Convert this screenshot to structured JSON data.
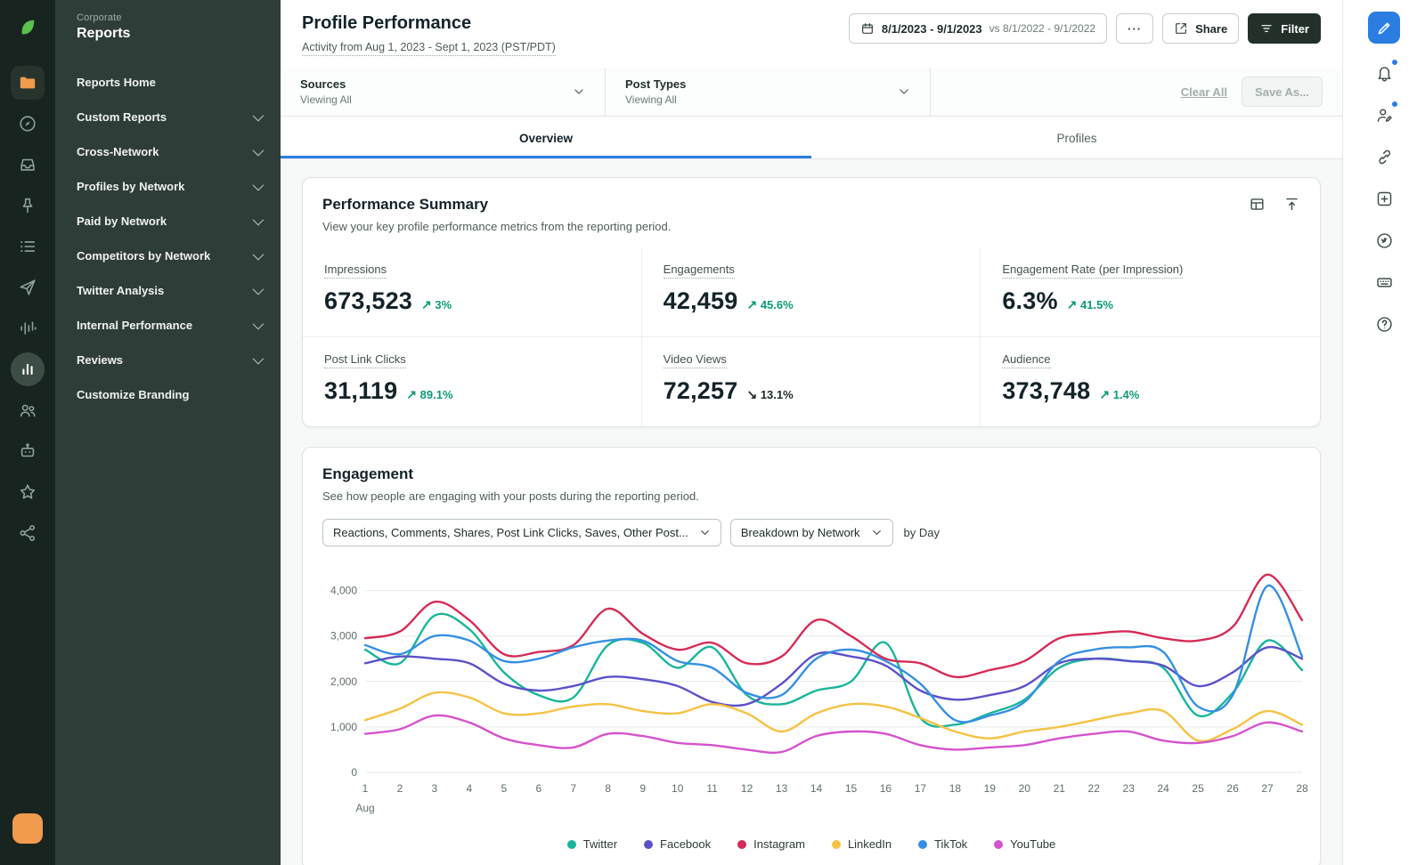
{
  "colors": {
    "accent_blue": "#2b7de1",
    "sprout_green": "#5bc14d",
    "rail_orange": "#f09b4e",
    "positive_trend": "#0c9a77",
    "filter_button_bg": "#233029"
  },
  "left_rail": {
    "icons": [
      "sprout-logo",
      "folder-icon",
      "compass-icon",
      "inbox-icon",
      "pin-icon",
      "list-icon",
      "send-icon",
      "listening-icon",
      "bar-chart-icon",
      "people-icon",
      "bot-icon",
      "star-icon",
      "network-icon",
      "avatar"
    ]
  },
  "right_rail": {
    "icons": [
      "compose-icon",
      "bell-icon",
      "user-edit-icon",
      "link-icon",
      "add-square-icon",
      "bird-icon",
      "keyboard-icon",
      "help-icon"
    ]
  },
  "sidebar": {
    "eyebrow": "Corporate",
    "title": "Reports",
    "items": [
      {
        "label": "Reports Home",
        "chevron": false
      },
      {
        "label": "Custom Reports",
        "chevron": true
      },
      {
        "label": "Cross-Network",
        "chevron": true
      },
      {
        "label": "Profiles by Network",
        "chevron": true
      },
      {
        "label": "Paid by Network",
        "chevron": true
      },
      {
        "label": "Competitors by Network",
        "chevron": true
      },
      {
        "label": "Twitter Analysis",
        "chevron": true
      },
      {
        "label": "Internal Performance",
        "chevron": true
      },
      {
        "label": "Reviews",
        "chevron": true
      },
      {
        "label": "Customize Branding",
        "chevron": false
      }
    ]
  },
  "header": {
    "title": "Profile Performance",
    "subtitle": "Activity from Aug 1, 2023 - Sept 1, 2023 (PST/PDT)",
    "date_range": "8/1/2023 - 9/1/2023",
    "date_compare": "vs 8/1/2022 - 9/1/2022",
    "more_label": "···",
    "share_label": "Share",
    "filter_label": "Filter"
  },
  "filters": {
    "sources_label": "Sources",
    "sources_value": "Viewing All",
    "post_types_label": "Post Types",
    "post_types_value": "Viewing All",
    "clear_all_label": "Clear All",
    "save_as_label": "Save As..."
  },
  "tabs": [
    {
      "label": "Overview",
      "active": true
    },
    {
      "label": "Profiles",
      "active": false
    }
  ],
  "performance_summary": {
    "title": "Performance Summary",
    "description": "View your key profile performance metrics from the reporting period.",
    "metrics": [
      {
        "label": "Impressions",
        "value": "673,523",
        "arrow": "↗",
        "trend": "3%",
        "direction": "up"
      },
      {
        "label": "Engagements",
        "value": "42,459",
        "arrow": "↗",
        "trend": "45.6%",
        "direction": "up"
      },
      {
        "label": "Engagement Rate (per Impression)",
        "value": "6.3%",
        "arrow": "↗",
        "trend": "41.5%",
        "direction": "up"
      },
      {
        "label": "Post Link Clicks",
        "value": "31,119",
        "arrow": "↗",
        "trend": "89.1%",
        "direction": "up"
      },
      {
        "label": "Video Views",
        "value": "72,257",
        "arrow": "↘",
        "trend": "13.1%",
        "direction": "down"
      },
      {
        "label": "Audience",
        "value": "373,748",
        "arrow": "↗",
        "trend": "1.4%",
        "direction": "up"
      }
    ]
  },
  "engagement": {
    "title": "Engagement",
    "description": "See how people are engaging with your posts during the reporting period.",
    "metric_select": "Reactions, Comments, Shares, Post Link Clicks, Saves, Other Post...",
    "breakdown_select": "Breakdown by Network",
    "granularity": "by Day"
  },
  "chart_data": {
    "type": "line",
    "title": "Engagement by Day, broken down by network",
    "x": [
      1,
      2,
      3,
      4,
      5,
      6,
      7,
      8,
      9,
      10,
      11,
      12,
      13,
      14,
      15,
      16,
      17,
      18,
      19,
      20,
      21,
      22,
      23,
      24,
      25,
      26,
      27,
      28
    ],
    "month_label": "Aug",
    "ymax": 4500,
    "ylim": [
      0,
      4500
    ],
    "grid": true,
    "legend_position": "bottom",
    "yticks": [
      {
        "value": 0,
        "label": "0"
      },
      {
        "value": 1000,
        "label": "1,000"
      },
      {
        "value": 2000,
        "label": "2,000"
      },
      {
        "value": 3000,
        "label": "3,000"
      },
      {
        "value": 4000,
        "label": "4,000"
      }
    ],
    "series": [
      {
        "name": "Twitter",
        "color": "#18b59b",
        "values": [
          2700,
          2400,
          3450,
          3150,
          2200,
          1700,
          1650,
          2800,
          2850,
          2300,
          2750,
          1700,
          1500,
          1800,
          2000,
          2850,
          1200,
          1050,
          1300,
          1600,
          2300,
          2500,
          2450,
          2300,
          1250,
          1750,
          2900,
          2250
        ]
      },
      {
        "name": "Facebook",
        "color": "#5b51c9",
        "values": [
          2400,
          2550,
          2500,
          2400,
          1950,
          1800,
          1900,
          2100,
          2050,
          1900,
          1550,
          1500,
          1950,
          2600,
          2550,
          2350,
          1800,
          1600,
          1700,
          1900,
          2400,
          2500,
          2450,
          2350,
          1900,
          2200,
          2750,
          2500
        ]
      },
      {
        "name": "Instagram",
        "color": "#d62b56",
        "values": [
          2950,
          3100,
          3750,
          3350,
          2600,
          2650,
          2800,
          3600,
          3050,
          2700,
          2850,
          2400,
          2550,
          3350,
          3000,
          2500,
          2400,
          2100,
          2250,
          2450,
          2950,
          3050,
          3100,
          2950,
          2900,
          3200,
          4350,
          3350
        ]
      },
      {
        "name": "LinkedIn",
        "color": "#f7c243",
        "values": [
          1150,
          1400,
          1750,
          1650,
          1300,
          1300,
          1450,
          1500,
          1350,
          1300,
          1500,
          1300,
          900,
          1300,
          1500,
          1450,
          1200,
          900,
          750,
          900,
          1000,
          1150,
          1300,
          1350,
          700,
          950,
          1350,
          1050
        ]
      },
      {
        "name": "TikTok",
        "color": "#3490e3",
        "values": [
          2800,
          2600,
          3000,
          2900,
          2450,
          2500,
          2750,
          2900,
          2900,
          2450,
          2300,
          1750,
          1700,
          2500,
          2700,
          2450,
          1950,
          1150,
          1250,
          1550,
          2450,
          2700,
          2750,
          2650,
          1450,
          1700,
          4100,
          2550
        ]
      },
      {
        "name": "YouTube",
        "color": "#d553cd",
        "values": [
          850,
          950,
          1250,
          1100,
          750,
          600,
          550,
          850,
          800,
          650,
          600,
          500,
          450,
          800,
          900,
          850,
          600,
          500,
          550,
          600,
          750,
          850,
          900,
          700,
          650,
          800,
          1100,
          900
        ]
      }
    ]
  }
}
